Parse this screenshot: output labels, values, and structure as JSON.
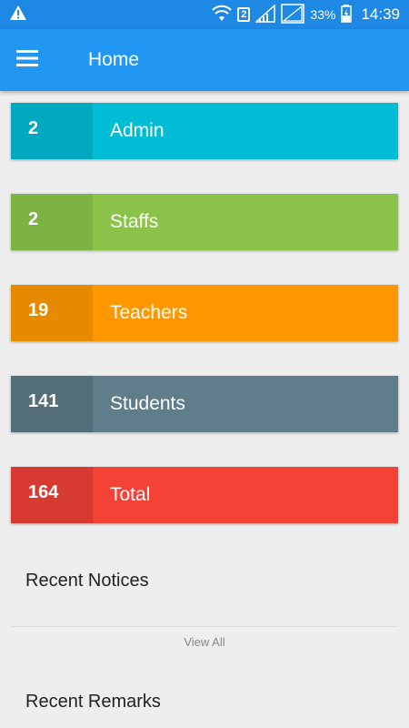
{
  "status_bar": {
    "warning_icon": "warning-icon",
    "sim_slot": "2",
    "battery": "33%",
    "time": "14:39"
  },
  "app_bar": {
    "title": "Home",
    "menu_icon": "hamburger-menu-icon"
  },
  "stats": [
    {
      "count": "2",
      "label": "Admin",
      "color_count": "#00a9c0",
      "color_label": "#00bcd4"
    },
    {
      "count": "2",
      "label": "Staffs",
      "color_count": "#7cb342",
      "color_label": "#8bc34a"
    },
    {
      "count": "19",
      "label": "Teachers",
      "color_count": "#e68a00",
      "color_label": "#ff9800"
    },
    {
      "count": "141",
      "label": "Students",
      "color_count": "#546e7a",
      "color_label": "#607d8b"
    },
    {
      "count": "164",
      "label": "Total",
      "color_count": "#d63a30",
      "color_label": "#f44336"
    }
  ],
  "recent_notices": {
    "title": "Recent Notices",
    "view_all": "View All"
  },
  "recent_remarks": {
    "title": "Recent Remarks"
  }
}
